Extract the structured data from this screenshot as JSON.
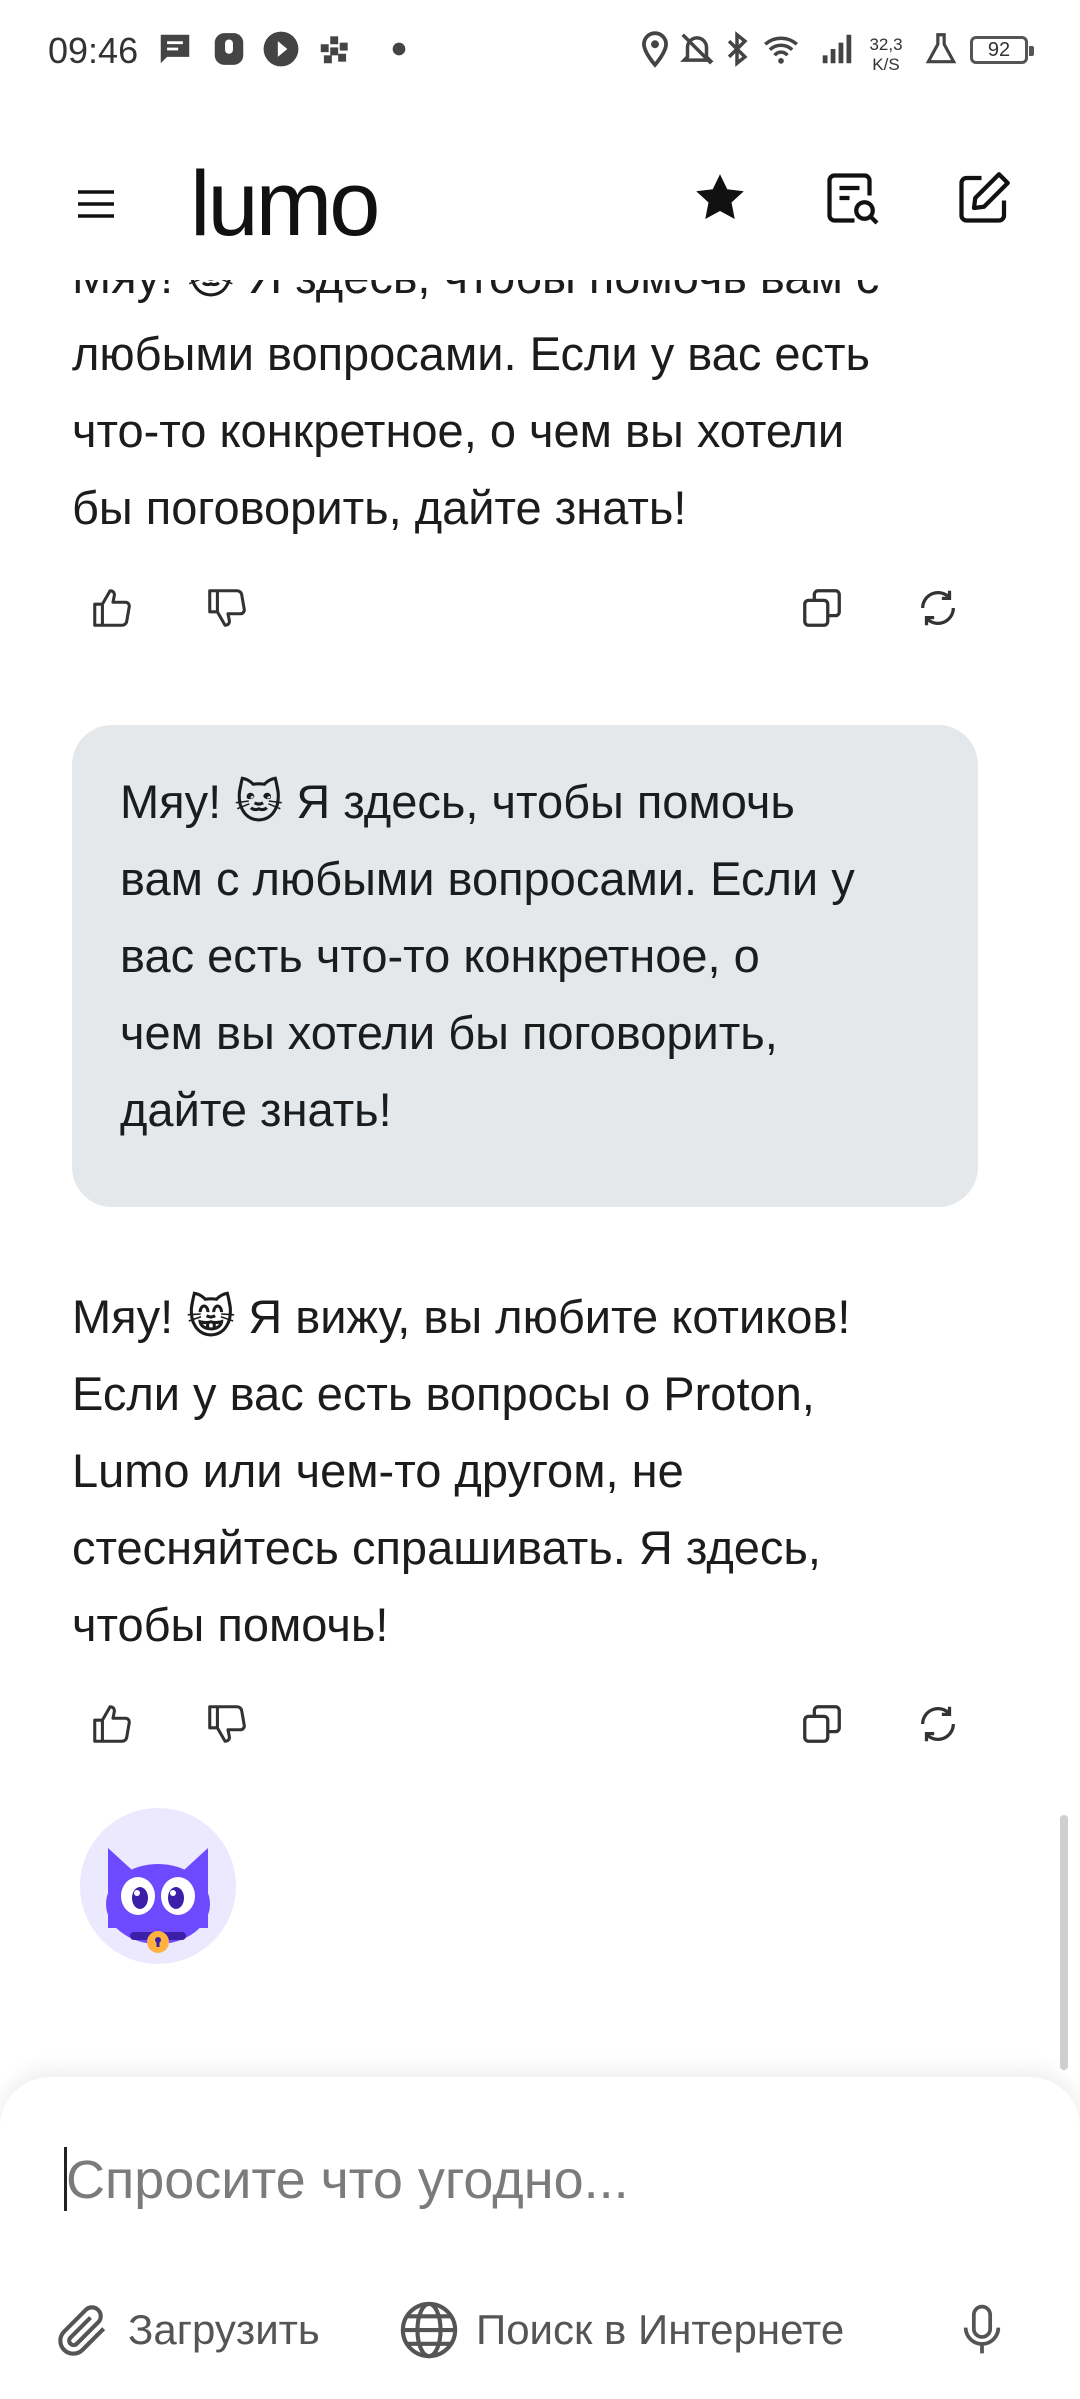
{
  "status_bar": {
    "time": "09:46",
    "network_speed_value": "32,3",
    "network_speed_unit": "K/S",
    "battery": "92",
    "icons": [
      "message-icon",
      "mic-notification-icon",
      "play-icon",
      "grid-app-icon",
      "dot-icon",
      "location-icon",
      "mute-bell-icon",
      "bluetooth-icon",
      "wifi-icon",
      "signal-icon",
      "lab-icon",
      "battery-icon"
    ]
  },
  "header": {
    "logo": "lumo",
    "icons": [
      "menu-icon",
      "star-icon",
      "search-chat-icon",
      "new-chat-icon"
    ]
  },
  "messages": [
    {
      "role": "assistant",
      "text": "Мяу! 🐱 Я здесь, чтобы помочь вам с любыми вопросами. Если у вас есть что-то конкретное, о чем вы хотели бы поговорить, дайте знать!",
      "visible_lines": [
        "любыми вопросами. Если у вас есть",
        "что-то конкретное, о чем вы хотели",
        "бы поговорить, дайте знать!"
      ],
      "partial_line": "Мяу! 🐱 Я здесь, чтобы помочь вам с"
    },
    {
      "role": "user",
      "lines": [
        "Мяу! 🐱 Я здесь, чтобы помочь",
        "вам с любыми вопросами. Если у",
        "вас есть что-то конкретное, о",
        "чем вы хотели бы поговорить,",
        "дайте знать!"
      ]
    },
    {
      "role": "assistant",
      "lines": [
        "Мяу! 😸 Я вижу, вы любите котиков!",
        "Если у вас есть вопросы о Proton,",
        "Lumo или чем-то другом, не",
        "стесняйтесь спрашивать. Я здесь,",
        "чтобы помочь!"
      ]
    }
  ],
  "message_actions": [
    "thumbs-up-icon",
    "thumbs-down-icon",
    "copy-icon",
    "regenerate-icon"
  ],
  "composer": {
    "placeholder": "Спросите что угодно...",
    "upload_label": "Загрузить",
    "web_search_label": "Поиск в Интернете"
  },
  "colors": {
    "user_bubble": "#e4e8eb",
    "avatar_bg": "#ece9ff",
    "mascot_purple": "#6d4aff",
    "text": "#1c1c1c"
  }
}
